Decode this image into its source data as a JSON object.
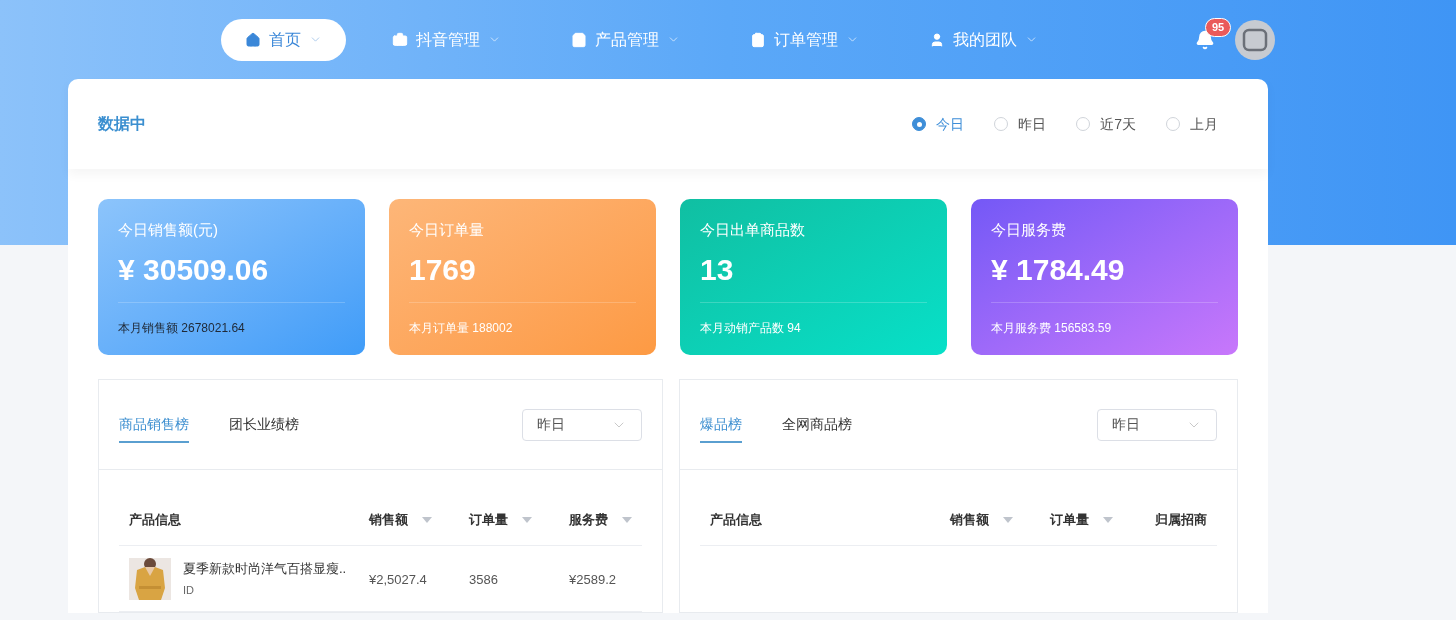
{
  "nav": {
    "items": [
      {
        "label": "首页",
        "selected": true
      },
      {
        "label": "抖音管理",
        "selected": false
      },
      {
        "label": "产品管理",
        "selected": false
      },
      {
        "label": "订单管理",
        "selected": false
      },
      {
        "label": "我的团队",
        "selected": false
      }
    ],
    "badge": "95"
  },
  "header": {
    "title": "数据中",
    "periods": [
      {
        "label": "今日",
        "selected": true
      },
      {
        "label": "昨日",
        "selected": false
      },
      {
        "label": "近7天",
        "selected": false
      },
      {
        "label": "上月",
        "selected": false
      }
    ]
  },
  "stats": [
    {
      "title": "今日销售额(元)",
      "value": "¥ 30509.06",
      "footer": "本月销售额 2678021.64"
    },
    {
      "title": "今日订单量",
      "value": "1769",
      "footer": "本月订单量 188002"
    },
    {
      "title": "今日出单商品数",
      "value": "13",
      "footer": "本月动销产品数 94"
    },
    {
      "title": "今日服务费",
      "value": "¥ 1784.49",
      "footer": "本月服务费 156583.59"
    }
  ],
  "panels": [
    {
      "tabs": [
        {
          "label": "商品销售榜",
          "selected": true
        },
        {
          "label": "团长业绩榜",
          "selected": false
        }
      ],
      "select": "昨日",
      "columns": [
        {
          "label": "产品信息",
          "sortable": false
        },
        {
          "label": "销售额",
          "sortable": true
        },
        {
          "label": "订单量",
          "sortable": true
        },
        {
          "label": "服务费",
          "sortable": true
        }
      ],
      "rows": [
        {
          "id": "ID",
          "cells": [
            "夏季新款时尚洋气百搭显瘦..",
            "¥2,5027.4",
            "3586",
            "¥2589.2"
          ]
        }
      ]
    },
    {
      "tabs": [
        {
          "label": "爆品榜",
          "selected": true
        },
        {
          "label": "全网商品榜",
          "selected": false
        }
      ],
      "select": "昨日",
      "columns": [
        {
          "label": "产品信息",
          "sortable": false
        },
        {
          "label": "销售额",
          "sortable": true
        },
        {
          "label": "订单量",
          "sortable": true
        },
        {
          "label": "归属招商",
          "sortable": false
        }
      ]
    }
  ]
}
